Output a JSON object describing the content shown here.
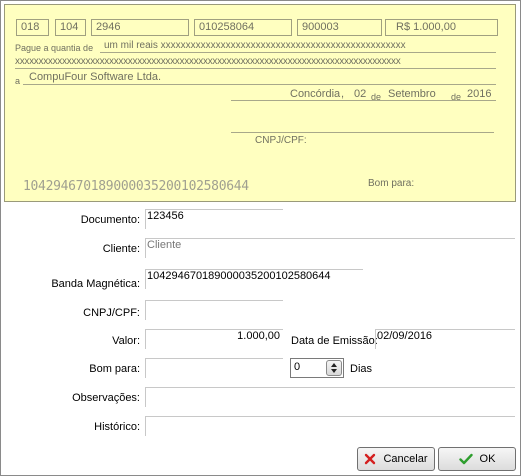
{
  "cheque": {
    "bank": "018",
    "agency": "104",
    "account": "2946",
    "cheque_number": "010258064",
    "serial": "900003",
    "amount": "R$ 1.000,00",
    "pague_label": "Pague a quantia de",
    "amount_words_line1": "um mil reais xxxxxxxxxxxxxxxxxxxxxxxxxxxxxxxxxxxxxxxxxxxxxxxxx",
    "amount_words_line2": "xxxxxxxxxxxxxxxxxxxxxxxxxxxxxxxxxxxxxxxxxxxxxxxxxxxxxxxxxxxxxxxxxxxxxxxxxxxxxxxxxx",
    "a_label": "a",
    "payee": "CompuFour Software Ltda.",
    "city": "Concórdia",
    "comma": ",",
    "day": "02",
    "de1": "de",
    "month": "Setembro",
    "de2": "de",
    "year": "2016",
    "cnpj_label": "CNPJ/CPF:",
    "micr": "104294670189000035200102580644",
    "bom_para_label": "Bom para:"
  },
  "form": {
    "documento_label": "Documento:",
    "documento_value": "123456",
    "cliente_label": "Cliente:",
    "cliente_placeholder": "Cliente",
    "banda_label": "Banda Magnética:",
    "banda_value": "104294670189000035200102580644",
    "cnpj_label": "CNPJ/CPF:",
    "cnpj_value": "",
    "valor_label": "Valor:",
    "valor_value": "1.000,00",
    "data_emissao_label": "Data de Emissão:",
    "data_emissao_value": "02/09/2016",
    "bom_para_label": "Bom para:",
    "bom_para_value": "",
    "dias_value": "0",
    "dias_label": "Dias",
    "observacoes_label": "Observações:",
    "observacoes_value": "",
    "historico_label": "Histórico:",
    "historico_value": ""
  },
  "buttons": {
    "cancel_label": "Cancelar",
    "ok_label": "OK",
    "cancel_icon": "x-icon",
    "ok_icon": "check-icon",
    "cancel_icon_color": "#d42020",
    "ok_icon_color": "#2e9e2e"
  }
}
